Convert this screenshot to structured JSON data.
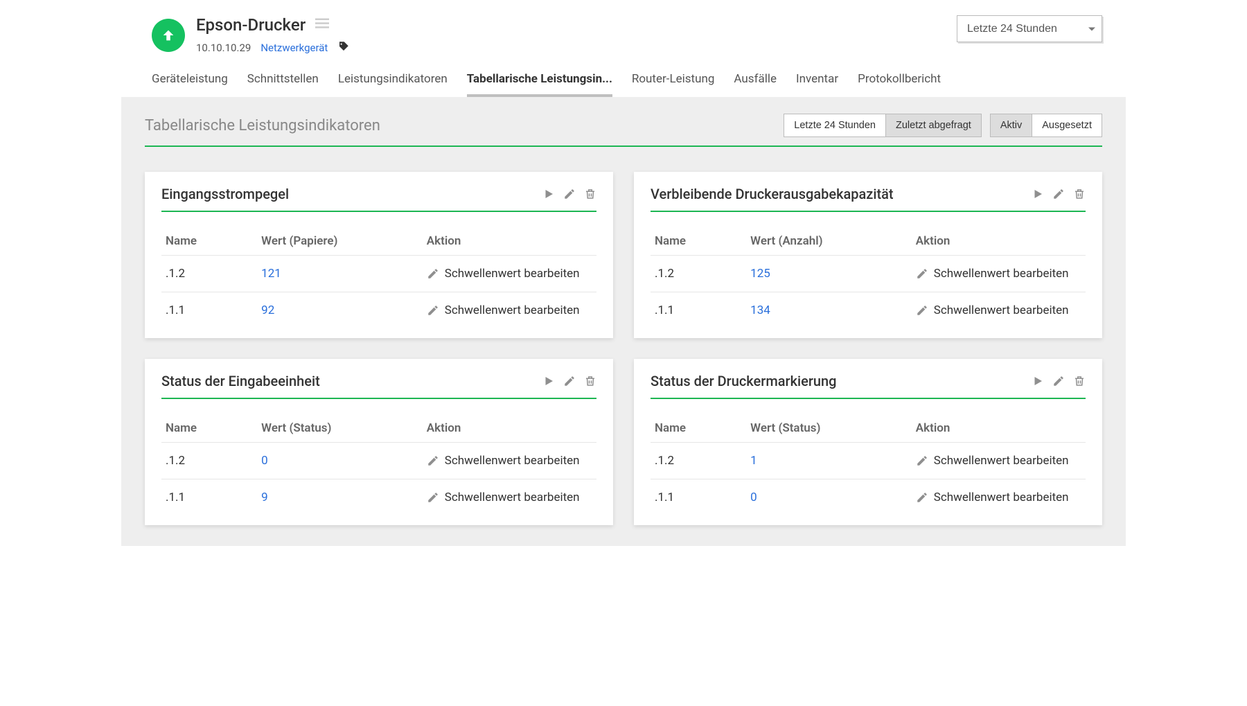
{
  "header": {
    "title": "Epson-Drucker",
    "ip": "10.10.10.29",
    "device_type": "Netzwerkgerät",
    "time_range": "Letzte 24 Stunden"
  },
  "tabs": [
    {
      "label": "Geräteleistung",
      "active": false
    },
    {
      "label": "Schnittstellen",
      "active": false
    },
    {
      "label": "Leistungsindikatoren",
      "active": false
    },
    {
      "label": "Tabellarische Leistungsin...",
      "active": true
    },
    {
      "label": "Router-Leistung",
      "active": false
    },
    {
      "label": "Ausfälle",
      "active": false
    },
    {
      "label": "Inventar",
      "active": false
    },
    {
      "label": "Protokollbericht",
      "active": false
    }
  ],
  "panel": {
    "title": "Tabellarische Leistungsindikatoren",
    "group1": [
      {
        "label": "Letzte 24 Stunden",
        "active": false
      },
      {
        "label": "Zuletzt abgefragt",
        "active": true
      }
    ],
    "group2": [
      {
        "label": "Aktiv",
        "active": true
      },
      {
        "label": "Ausgesetzt",
        "active": false
      }
    ]
  },
  "columns": {
    "name": "Name",
    "aktion": "Aktion"
  },
  "action_label": "Schwellenwert bearbeiten",
  "cards": [
    {
      "title": "Eingangsstrompegel",
      "wert_col": "Wert (Papiere)",
      "rows": [
        {
          "name": ".1.2",
          "wert": "121"
        },
        {
          "name": ".1.1",
          "wert": "92"
        }
      ]
    },
    {
      "title": "Verbleibende Druckerausgabekapazität",
      "wert_col": "Wert (Anzahl)",
      "rows": [
        {
          "name": ".1.2",
          "wert": "125"
        },
        {
          "name": ".1.1",
          "wert": "134"
        }
      ]
    },
    {
      "title": "Status der Eingabeeinheit",
      "wert_col": "Wert (Status)",
      "rows": [
        {
          "name": ".1.2",
          "wert": "0"
        },
        {
          "name": ".1.1",
          "wert": "9"
        }
      ]
    },
    {
      "title": "Status der Druckermarkierung",
      "wert_col": "Wert (Status)",
      "rows": [
        {
          "name": ".1.2",
          "wert": "1"
        },
        {
          "name": ".1.1",
          "wert": "0"
        }
      ]
    }
  ]
}
